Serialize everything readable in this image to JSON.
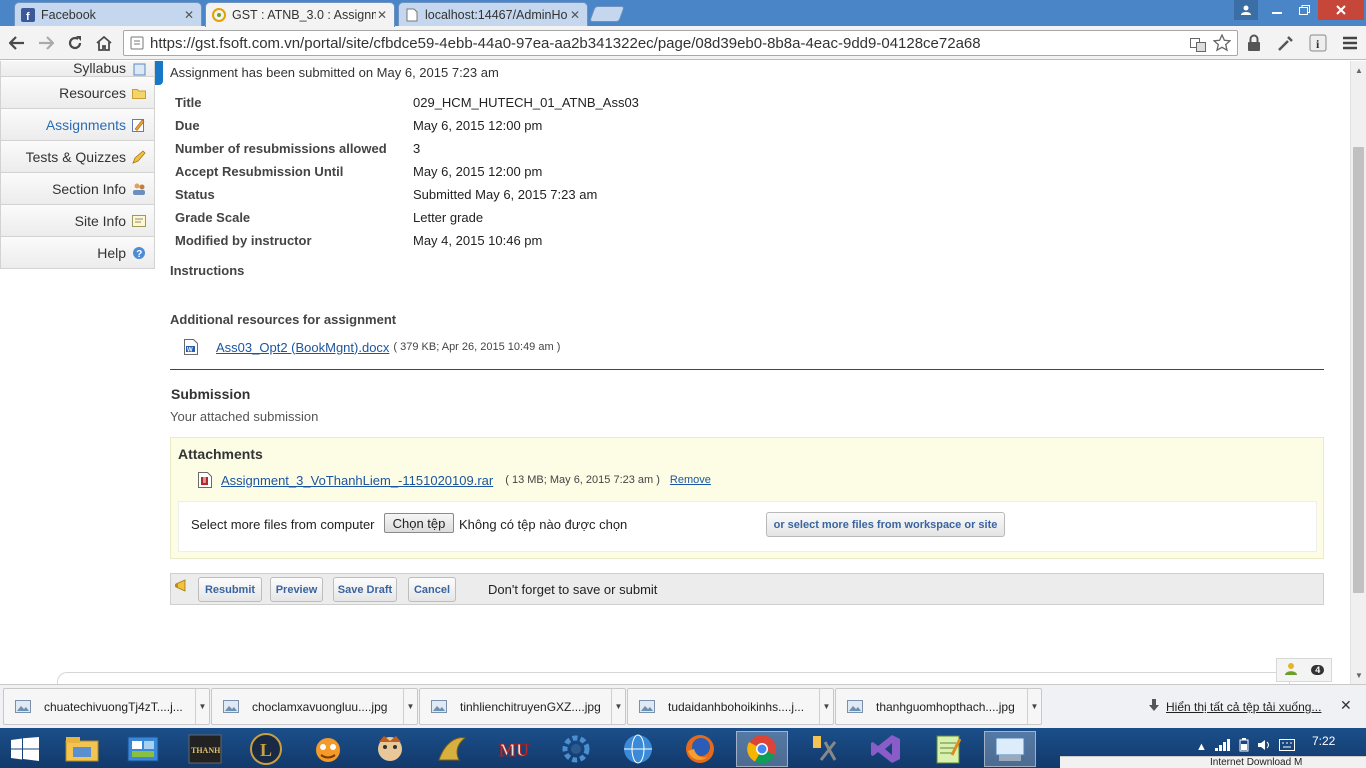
{
  "browser": {
    "tabs": [
      {
        "label": "Facebook",
        "icon": "facebook-icon",
        "close": "✕"
      },
      {
        "label": "GST : ATNB_3.0 : Assignm",
        "icon": "sakai-icon",
        "close": "✕"
      },
      {
        "label": "localhost:14467/AdminHo",
        "icon": "page-icon",
        "close": "✕"
      }
    ],
    "url": "https://gst.fsoft.com.vn/portal/site/cfbdce59-4ebb-44a0-97ea-aa2b341322ec/page/08d39eb0-8b8a-4eac-9dd9-04128ce72a68"
  },
  "tool_menu": {
    "items": [
      {
        "label": "Syllabus",
        "icon": "syllabus-icon"
      },
      {
        "label": "Resources",
        "icon": "folder-icon"
      },
      {
        "label": "Assignments",
        "icon": "assignment-icon"
      },
      {
        "label": "Tests & Quizzes",
        "icon": "pencil-icon"
      },
      {
        "label": "Section Info",
        "icon": "group-icon"
      },
      {
        "label": "Site Info",
        "icon": "site-info-icon"
      },
      {
        "label": "Help",
        "icon": "help-icon"
      }
    ],
    "current": "Assignments"
  },
  "assignment": {
    "submitted_note": "Assignment has been submitted on May 6, 2015 7:23 am",
    "properties": [
      {
        "label": "Title",
        "value": "029_HCM_HUTECH_01_ATNB_Ass03"
      },
      {
        "label": "Due",
        "value": "May 6, 2015 12:00 pm"
      },
      {
        "label": "Number of resubmissions allowed",
        "value": "3"
      },
      {
        "label": "Accept Resubmission Until",
        "value": "May 6, 2015 12:00 pm"
      },
      {
        "label": "Status",
        "value": "Submitted May 6, 2015 7:23 am"
      },
      {
        "label": "Grade Scale",
        "value": "Letter grade"
      },
      {
        "label": "Modified by instructor",
        "value": "May 4, 2015 10:46 pm"
      }
    ],
    "instructions_label": "Instructions",
    "resources_label": "Additional resources for assignment",
    "resource": {
      "name": "Ass03_Opt2 (BookMgnt).docx",
      "meta": "( 379 KB; Apr 26, 2015 10:49 am )"
    }
  },
  "submission": {
    "heading": "Submission",
    "subtitle": "Your attached submission",
    "attachments_heading": "Attachments",
    "attachment": {
      "name": "Assignment_3_VoThanhLiem_-1151020109.rar",
      "meta": "( 13 MB; May 6, 2015 7:23 am )",
      "remove_label": "Remove"
    },
    "select_label": "Select more files from computer",
    "choose_button": "Chọn tệp",
    "no_file_text": "Không có tệp nào được chọn",
    "workspace_button": "or select more files from workspace or site"
  },
  "actions": {
    "resubmit": "Resubmit",
    "preview": "Preview",
    "save_draft": "Save Draft",
    "cancel": "Cancel",
    "note": "Don't forget to save or submit"
  },
  "presence": {
    "count": "4"
  },
  "downloads": {
    "items": [
      "chuatechivuongTj4zT....j...",
      "choclamxavuongluu....jpg",
      "tinhlienchitruyenGXZ....jpg",
      "tudaidanhbohoikinhs....j...",
      "thanhguomhopthach....jpg"
    ],
    "show_all": "Hiển thị tất cả tệp tải xuống...",
    "close": "✕"
  },
  "taskbar": {
    "time": "7:22",
    "popup_text": "Internet Download M"
  }
}
